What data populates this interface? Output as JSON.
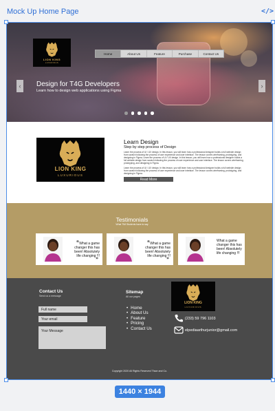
{
  "frame": {
    "title": "Mock Up Home Page",
    "code_icon": "</>",
    "size_label": "1440 × 1944"
  },
  "hero": {
    "logo_text": "LION KING",
    "logo_subtext": "LUXURIOUS",
    "nav": [
      "Home",
      "About Us",
      "Feature",
      "Purchase",
      "Contact Us"
    ],
    "title": "Design for T4G Developers",
    "subtitle": "Learn how to design web applications using Figma",
    "arrow_left": "‹",
    "arrow_right": "›",
    "slide_count": 5,
    "active_slide": 1
  },
  "learn": {
    "logo_text": "LION KING",
    "logo_subtext": "LUXURIOUS",
    "title": "Learn Design",
    "subtitle": "Step by step process of Design",
    "paragraph1": "Learn the process of UI / UX design. In this lesson, you will learn how a professional designer builds a full website design from scratch following the process of user experience and user interface. The lesson covers wireframing, prototyping, and designing in Figma. Learn the process of UI / UX design. In this lesson, you will learn how a professional designer builds a full website design from scratch following the process of user experience and user interface. The lesson covers wireframing, prototyping, and designing in Figma.",
    "paragraph2": "Learn the process of UI / UX design. In this lesson, you will learn how a professional designer builds a full website design from scratch following the process of user experience and user interface. The lesson covers wireframing, prototyping, and designing in Figma.",
    "button": "Read More"
  },
  "testimonials": {
    "title": "Testimonials",
    "subtitle": "What TIM Students have to say",
    "cards": [
      {
        "quote": "What a game changer this has been! Absolutely life changing !!!"
      },
      {
        "quote": "What a game changer this has been! Absolutely life changing !!!"
      },
      {
        "quote": "What a game changer this has been! Absolutely life changing !!!"
      }
    ]
  },
  "footer": {
    "contact_title": "Contact Us",
    "contact_sub": "Send us a message",
    "name_placeholder": "Full name",
    "email_placeholder": "Your email",
    "message_placeholder": "Your Message",
    "sitemap_title": "Sitemap",
    "sitemap_sub": "All our pages",
    "links": [
      "Home",
      "About Us",
      "Feature",
      "Pricing",
      "Contact Us"
    ],
    "logo_text": "LION KING",
    "logo_subtext": "LUXURIOUS",
    "phone": "(233) 59 796 1103",
    "email": "elpediaarthurjunior@gmail.com",
    "copyright": "Copyright 2020 All Rights Reserved Tface and Co."
  },
  "colors": {
    "accent": "#3c82e0",
    "brand_gold": "#d9ad57",
    "testimonial_bg": "#b49c66",
    "footer_bg": "#4a4a4a"
  },
  "icons": [
    "code-icon",
    "chevron-left-icon",
    "chevron-right-icon",
    "lion-logo-icon",
    "quote-icon",
    "phone-icon",
    "mail-icon"
  ]
}
